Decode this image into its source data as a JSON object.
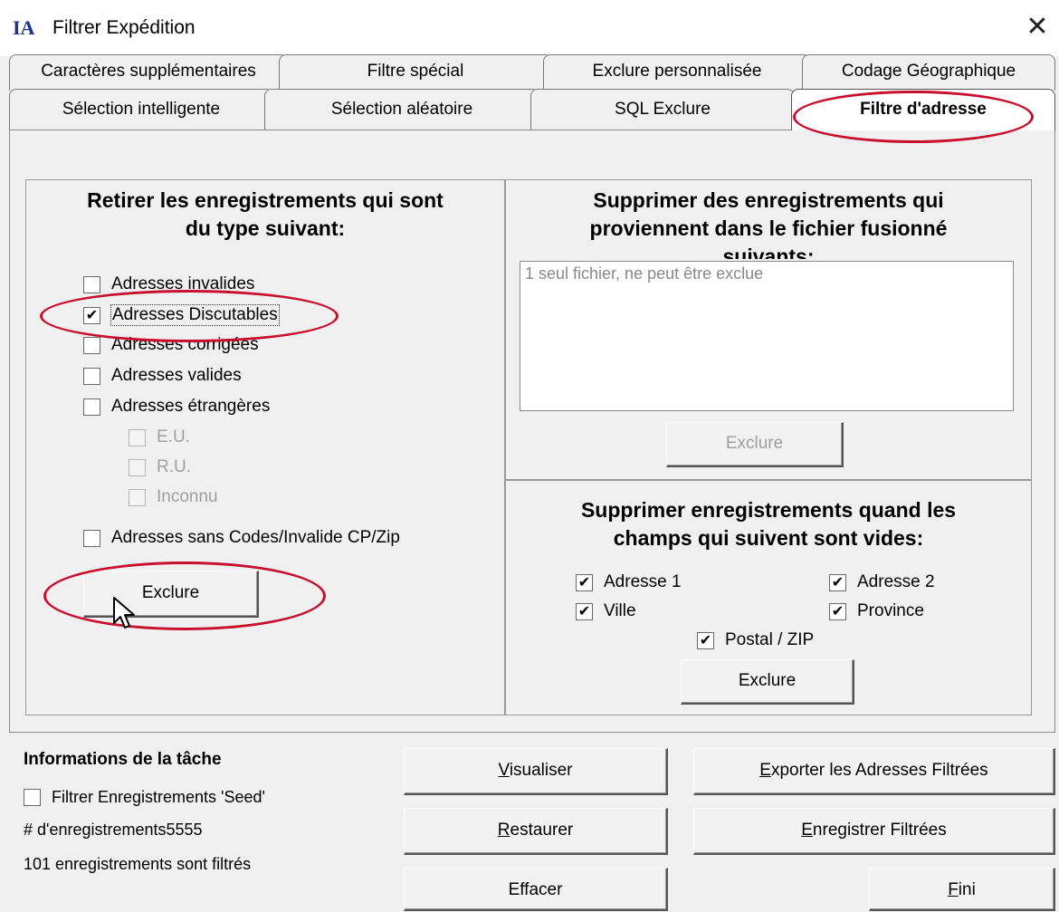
{
  "window": {
    "title": "Filtrer Expédition",
    "logo": "IA",
    "close_glyph": "✕"
  },
  "tabs": {
    "row1": [
      "Caractères supplémentaires",
      "Filtre spécial",
      "Exclure personnalisée",
      "Codage Géographique"
    ],
    "row2": [
      "Sélection intelligente",
      "Sélection aléatoire",
      "SQL Exclure",
      "Filtre d'adresse"
    ],
    "active": "Filtre d'adresse"
  },
  "left_panel": {
    "heading_line1": "Retirer les enregistrements qui sont",
    "heading_line2": "du type suivant:",
    "options": [
      {
        "label": "Adresses invalides",
        "checked": false
      },
      {
        "label": "Adresses Discutables",
        "checked": true
      },
      {
        "label": "Adresses corrigées",
        "checked": false
      },
      {
        "label": "Adresses valides",
        "checked": false
      },
      {
        "label": "Adresses étrangères",
        "checked": false
      }
    ],
    "foreign_sub": [
      {
        "label": "E.U.",
        "checked": false,
        "enabled": false
      },
      {
        "label": "R.U.",
        "checked": false,
        "enabled": false
      },
      {
        "label": "Inconnu",
        "checked": false,
        "enabled": false
      }
    ],
    "no_codes": {
      "label": "Adresses sans Codes/Invalide CP/Zip",
      "checked": false
    },
    "exclude_button": "Exclure"
  },
  "merge_panel": {
    "heading_line1": "Supprimer des enregistrements qui",
    "heading_line2": "proviennent dans le fichier fusionné",
    "heading_line3": "suivants:",
    "list_text": "1 seul fichier, ne peut être exclue",
    "exclude_button": "Exclure"
  },
  "empty_fields_panel": {
    "heading_line1": "Supprimer enregistrements quand les",
    "heading_line2": "champs qui suivent sont vides:",
    "fields": {
      "adresse1": {
        "label": "Adresse 1",
        "checked": true
      },
      "adresse2": {
        "label": "Adresse 2",
        "checked": true
      },
      "ville": {
        "label": "Ville",
        "checked": true
      },
      "province": {
        "label": "Province",
        "checked": true
      },
      "postal": {
        "label": "Postal / ZIP",
        "checked": true
      }
    },
    "exclude_button": "Exclure"
  },
  "task_info": {
    "title": "Informations de la tâche",
    "seed_label": "Filtrer Enregistrements 'Seed'",
    "seed_checked": false,
    "records_count": "# d'enregistrements5555",
    "filtered_text": "101 enregistrements sont filtrés"
  },
  "bottom_buttons": {
    "visualiser": {
      "mnemonic": "V",
      "rest": "isualiser"
    },
    "restaurer": {
      "mnemonic": "R",
      "rest": "estaurer"
    },
    "effacer": "Effacer",
    "exporter": {
      "mnemonic": "E",
      "rest": "xporter les Adresses Filtrées"
    },
    "enregistrer": {
      "mnemonic": "E",
      "rest": "nregistrer Filtrées"
    },
    "fini": {
      "mnemonic": "F",
      "rest": "ini"
    }
  },
  "colors": {
    "annotation": "#c8102e",
    "logo": "#1c2f8c",
    "window_bg": "#f0f0f0"
  },
  "check_glyph": "✔"
}
